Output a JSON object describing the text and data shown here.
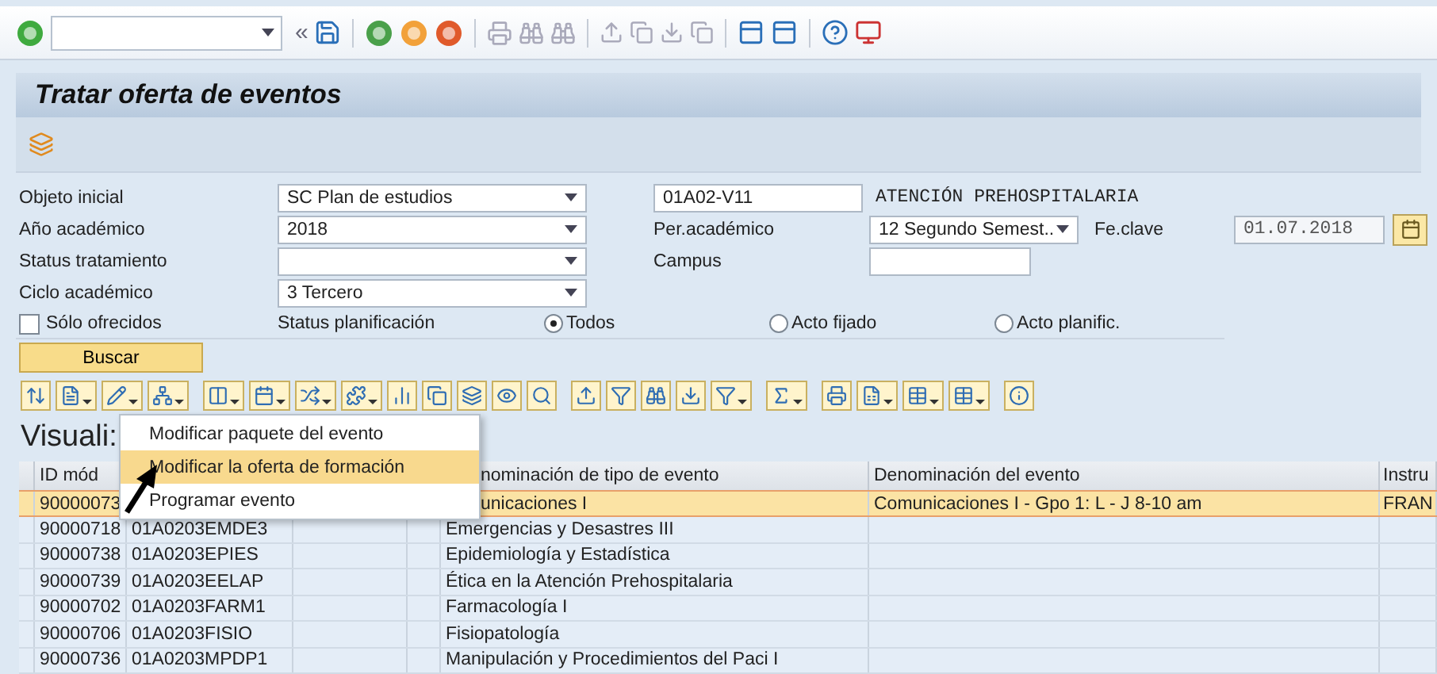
{
  "toolbar": {
    "collapse_glyph": "«"
  },
  "title": "Tratar oferta de eventos",
  "form": {
    "objeto_inicial": {
      "label": "Objeto inicial",
      "value": "SC Plan de estudios",
      "code": "01A02-V11",
      "description": "ATENCIÓN PREHOSPITALARIA"
    },
    "ano_academico": {
      "label": "Año académico",
      "value": "2018"
    },
    "per_academico": {
      "label": "Per.académico",
      "value": "12 Segundo Semest.."
    },
    "fe_clave": {
      "label": "Fe.clave",
      "value": "01.07.2018"
    },
    "status_tratamiento": {
      "label": "Status tratamiento"
    },
    "campus": {
      "label": "Campus"
    },
    "ciclo_academico": {
      "label": "Ciclo académico",
      "value": "3 Tercero"
    },
    "solo_ofrecidos": {
      "label": "Sólo ofrecidos",
      "checked": false
    },
    "status_planificacion": {
      "label": "Status planificación",
      "options": [
        {
          "label": "Todos",
          "selected": true
        },
        {
          "label": "Acto fijado",
          "selected": false
        },
        {
          "label": "Acto planific.",
          "selected": false
        }
      ]
    },
    "search_button": "Buscar"
  },
  "list_title": "Visuali:",
  "table": {
    "columns": [
      "ID mód",
      "",
      "",
      "",
      "nominación de tipo de evento",
      "Denominación del evento",
      "Instru"
    ],
    "rows": [
      {
        "selected": true,
        "cells": [
          "90000073",
          "",
          "",
          "",
          "unicaciones I",
          "Comunicaciones I - Gpo 1: L - J 8-10 am",
          "FRAN"
        ]
      },
      {
        "selected": false,
        "cells": [
          "90000718",
          "01A0203EMDE3",
          "",
          "",
          "Emergencias y Desastres III",
          "",
          ""
        ]
      },
      {
        "selected": false,
        "cells": [
          "90000738",
          "01A0203EPIES",
          "",
          "",
          "Epidemiología y Estadística",
          "",
          ""
        ]
      },
      {
        "selected": false,
        "cells": [
          "90000739",
          "01A0203EELAP",
          "",
          "",
          "Ética en la Atención Prehospitalaria",
          "",
          ""
        ]
      },
      {
        "selected": false,
        "cells": [
          "90000702",
          "01A0203FARM1",
          "",
          "",
          "Farmacología I",
          "",
          ""
        ]
      },
      {
        "selected": false,
        "cells": [
          "90000706",
          "01A0203FISIO",
          "",
          "",
          "Fisiopatología",
          "",
          ""
        ]
      },
      {
        "selected": false,
        "cells": [
          "90000736",
          "01A0203MPDP1",
          "",
          "",
          "Manipulación y Procedimientos del Paci I",
          "",
          ""
        ]
      }
    ]
  },
  "context_menu": {
    "items": [
      {
        "label": "Modificar paquete del evento",
        "selected": false
      },
      {
        "label": "Modificar la oferta de formación",
        "selected": true
      },
      {
        "label": "Programar evento",
        "selected": false
      }
    ]
  }
}
